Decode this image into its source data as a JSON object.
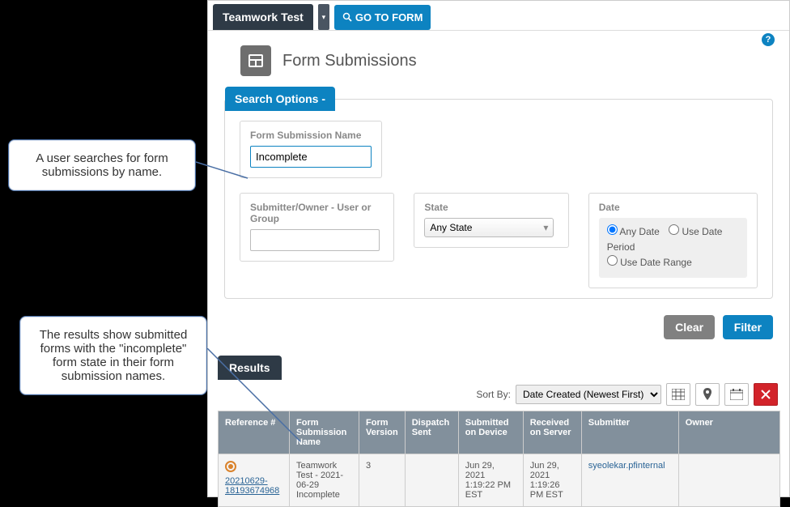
{
  "header": {
    "tab_label": "Teamwork Test",
    "go_form_label": "GO TO FORM"
  },
  "page": {
    "title": "Form Submissions"
  },
  "search": {
    "section_label": "Search Options -",
    "name_label": "Form Submission Name",
    "name_value": "Incomplete",
    "submitter_label": "Submitter/Owner - User or Group",
    "submitter_value": "",
    "state_label": "State",
    "state_value": "Any State",
    "date_label": "Date",
    "date_opt_any": "Any Date",
    "date_opt_period": "Use Date Period",
    "date_opt_range": "Use Date Range",
    "clear_label": "Clear",
    "filter_label": "Filter"
  },
  "results": {
    "section_label": "Results",
    "sort_label": "Sort By:",
    "sort_value": "Date Created (Newest First)",
    "columns": {
      "ref": "Reference #",
      "name": "Form Submission Name",
      "version": "Form Version",
      "dispatch": "Dispatch Sent",
      "submitted": "Submitted on Device",
      "received": "Received on Server",
      "submitter": "Submitter",
      "owner": "Owner"
    },
    "rows": [
      {
        "ref": "20210629-18193674968",
        "name": "Teamwork Test - 2021-06-29 Incomplete",
        "version": "3",
        "dispatch": "",
        "submitted": "Jun 29, 2021 1:19:22 PM EST",
        "received": "Jun 29, 2021 1:19:26 PM EST",
        "submitter": "syeolekar.pfinternal",
        "owner": ""
      }
    ]
  },
  "callouts": {
    "c1": "A user searches for form submissions by name.",
    "c2": "The results show submitted forms with the \"incomplete\" form state in their form submission names."
  }
}
